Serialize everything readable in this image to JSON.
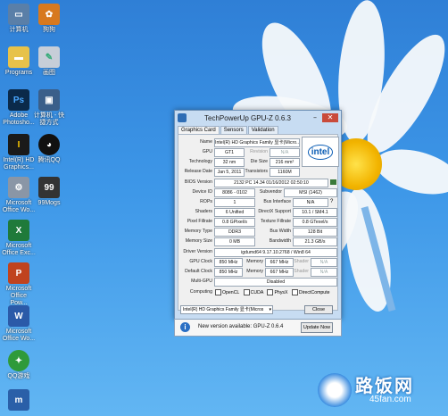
{
  "desktop": {
    "icons": [
      {
        "label": "计算机",
        "icon": "computer-icon"
      },
      {
        "label": "狗狗",
        "icon": "puzzle-icon"
      },
      {
        "label": "Programs",
        "icon": "folder-icon"
      },
      {
        "label": "画图",
        "icon": "paint-icon"
      },
      {
        "label": "Adobe Photosho...",
        "icon": "photoshop-icon"
      },
      {
        "label": "计算机 - 快捷方式",
        "icon": "shortcut-icon"
      },
      {
        "label": "Intel(R) HD Graphics...",
        "icon": "intel-icon"
      },
      {
        "label": "腾讯QQ",
        "icon": "qq-icon"
      },
      {
        "label": "Microsoft Office Wo...",
        "icon": "office-icon"
      },
      {
        "label": "99Mogs",
        "icon": "game-icon"
      },
      {
        "label": "Microsoft Office Exc...",
        "icon": "excel-icon"
      },
      {
        "label": "Microsoft Office Pow...",
        "icon": "powerpoint-icon"
      },
      {
        "label": "Microsoft Office Wo...",
        "icon": "word-icon"
      },
      {
        "label": "QQ游戏",
        "icon": "qqgame-icon"
      },
      {
        "label": "",
        "icon": "app-icon"
      }
    ]
  },
  "gpuz": {
    "title": "TechPowerUp GPU-Z 0.6.3",
    "tabs": [
      "Graphics Card",
      "Sensors",
      "Validation"
    ],
    "name": {
      "label": "Name",
      "value": "Intel(R) HD Graphics Family 显卡(Micro..."
    },
    "gpu": {
      "label": "GPU",
      "value": "GT1",
      "rev_label": "Revision",
      "rev_value": "N/A"
    },
    "tech": {
      "label": "Technology",
      "value": "32 nm",
      "die_label": "Die Size",
      "die_value": "216 mm²"
    },
    "release": {
      "label": "Release Date",
      "value": "Jan 5, 2011",
      "trans_label": "Transistors",
      "trans_value": "1160M"
    },
    "bios": {
      "label": "BIOS Version",
      "value": "2132 PC 14.34  01/16/2012  02:50:10"
    },
    "device": {
      "label": "Device ID",
      "value": "8086 - 0102",
      "sub_label": "Subvendor",
      "sub_value": "MSI (1462)"
    },
    "rops": {
      "label": "ROPs",
      "value": "1",
      "bus_label": "Bus Interface",
      "bus_value": "N/A"
    },
    "shaders": {
      "label": "Shaders",
      "value": "6 Unified",
      "dx_label": "DirectX Support",
      "dx_value": "10.1 / SM4.1"
    },
    "pixel": {
      "label": "Pixel Fillrate",
      "value": "0.8 GPixel/s",
      "tex_label": "Texture Fillrate",
      "tex_value": "0.8 GTexel/s"
    },
    "memtype": {
      "label": "Memory Type",
      "value": "DDR3",
      "bw_label": "Bus Width",
      "bw_value": "128 Bit"
    },
    "memsize": {
      "label": "Memory Size",
      "value": "0 MB",
      "band_label": "Bandwidth",
      "band_value": "21.3 GB/s"
    },
    "driver": {
      "label": "Driver Version",
      "value": "igdumd64 9.17.10.2768 / Win8 64"
    },
    "gpuclock": {
      "label": "GPU Clock",
      "value": "850 MHz",
      "mem_label": "Memory",
      "mem_value": "667 MHz",
      "sh_label": "Shader",
      "sh_value": "N/A"
    },
    "defclock": {
      "label": "Default Clock",
      "value": "850 MHz",
      "mem_label": "Memory",
      "mem_value": "667 MHz",
      "sh_label": "Shader",
      "sh_value": "N/A"
    },
    "multigpu": {
      "label": "Multi-GPU",
      "value": "Disabled"
    },
    "computing": {
      "label": "Computing",
      "opencl": "OpenCL",
      "cuda": "CUDA",
      "physx": "PhysX",
      "dc": "DirectCompute"
    },
    "select_value": "Intel(R) HD Graphics Family 显卡(Micros",
    "close_label": "Close",
    "logo_text": "intel"
  },
  "notify": {
    "message": "New version available: GPU-Z 0.6.4",
    "button": "Update Now",
    "icon": "info-icon"
  },
  "watermark": {
    "title": "路饭网",
    "url": "45fan.com"
  }
}
